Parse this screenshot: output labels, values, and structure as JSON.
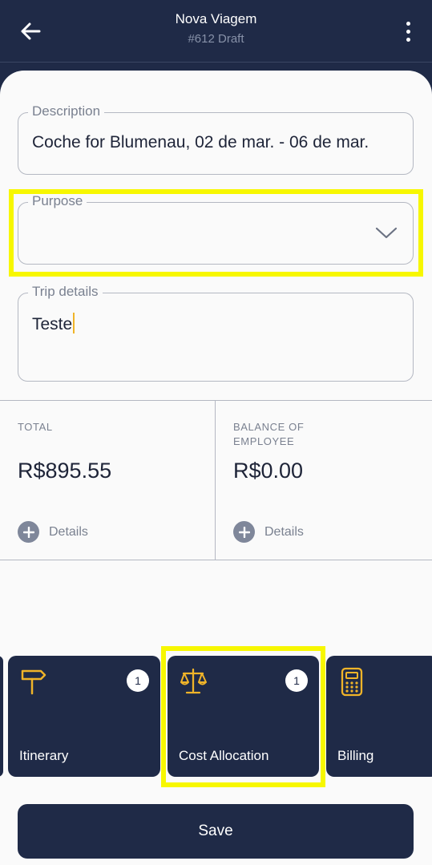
{
  "header": {
    "title": "Nova Viagem",
    "subtitle": "#612 Draft"
  },
  "form": {
    "description": {
      "label": "Description",
      "value": "Coche for Blumenau, 02 de mar. - 06 de mar."
    },
    "purpose": {
      "label": "Purpose",
      "value": ""
    },
    "trip_details": {
      "label": "Trip details",
      "value": "Teste"
    }
  },
  "summary": {
    "total": {
      "label": "TOTAL",
      "value": "R$895.55",
      "details_label": "Details"
    },
    "balance": {
      "label": "BALANCE OF EMPLOYEE",
      "value": "R$0.00",
      "details_label": "Details"
    }
  },
  "tiles": [
    {
      "label": "Itinerary",
      "badge": "1",
      "icon": "signpost-icon"
    },
    {
      "label": "Cost Allocation",
      "badge": "1",
      "icon": "scales-icon"
    },
    {
      "label": "Billing",
      "icon": "calculator-icon"
    }
  ],
  "actions": {
    "save_label": "Save"
  },
  "colors": {
    "navy": "#1f2a47",
    "accent": "#f0b429",
    "highlight": "#f7f700"
  }
}
